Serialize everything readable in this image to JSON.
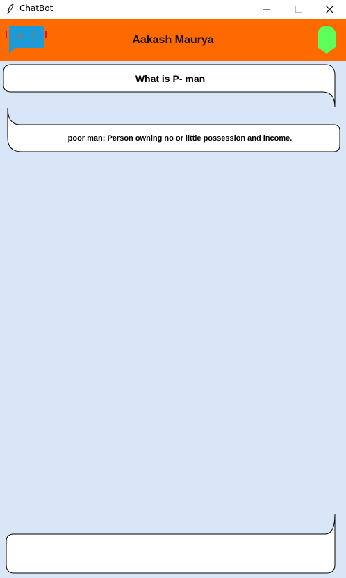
{
  "window": {
    "title": "ChatBot"
  },
  "header": {
    "user_name": "Aakash Maurya",
    "bot_icon": "chat-bubble-icon",
    "status_icon": "online-status-icon",
    "colors": {
      "header_bg": "#ff6a00",
      "bot_icon": "#1e9bd7",
      "status": "#5cff5c",
      "chat_bg": "#d9e6f8"
    }
  },
  "messages": [
    {
      "role": "user",
      "text": "What is P- man"
    },
    {
      "role": "bot",
      "text": "poor man: Person owning no or little possession and income."
    }
  ],
  "input": {
    "value": "",
    "placeholder": ""
  }
}
